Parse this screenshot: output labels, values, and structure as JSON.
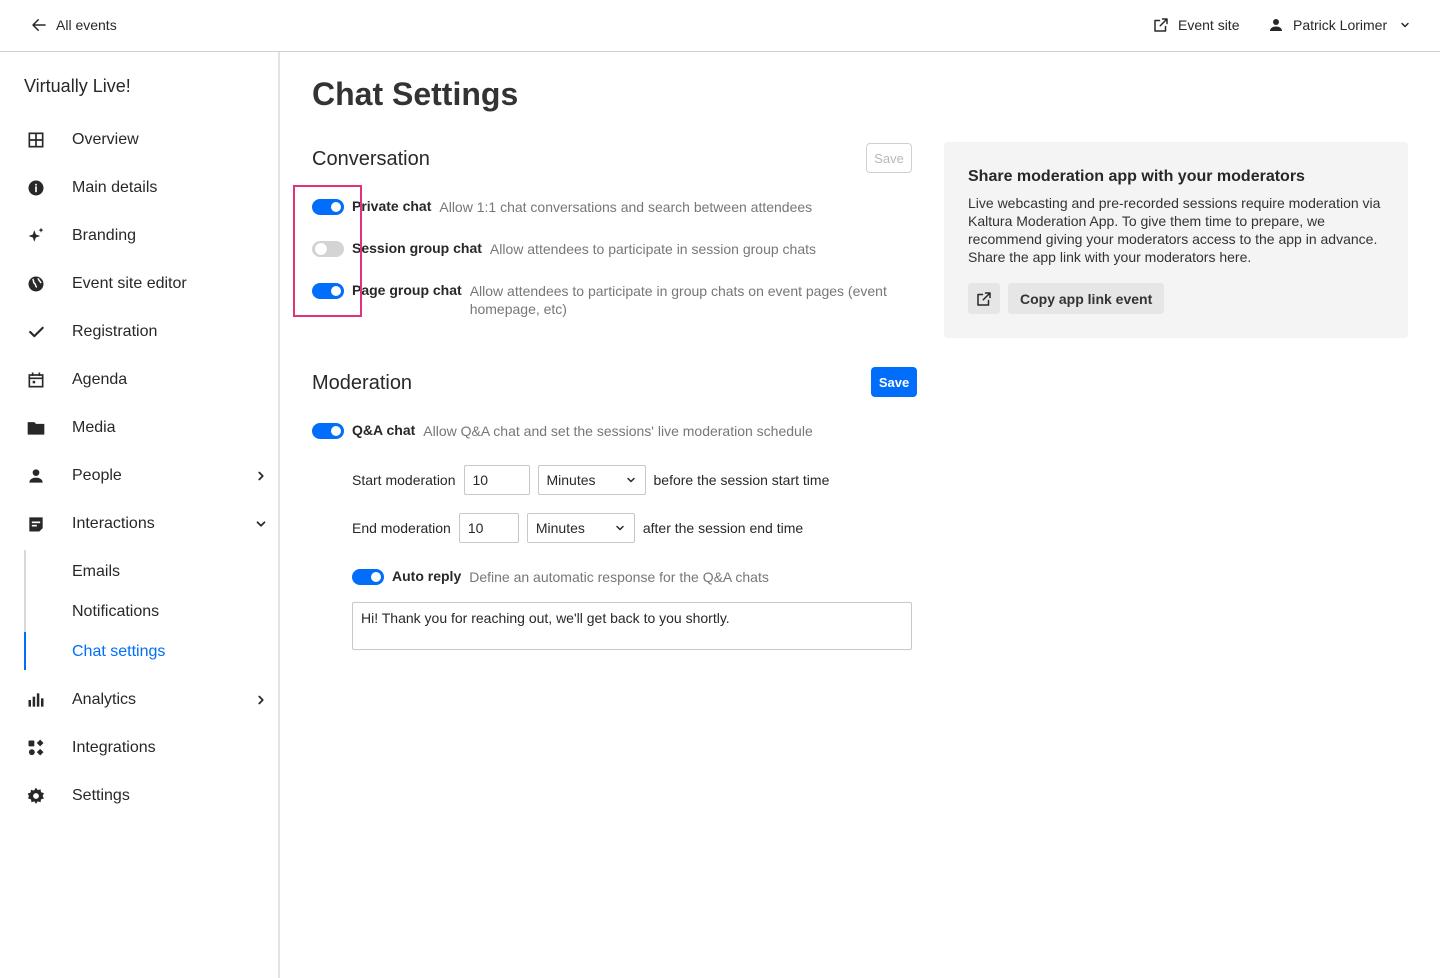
{
  "topbar": {
    "back_label": "All events",
    "event_site_label": "Event site",
    "user_name": "Patrick Lorimer"
  },
  "sidebar": {
    "title": "Virtually Live!",
    "items": [
      {
        "label": "Overview",
        "icon": "grid-icon"
      },
      {
        "label": "Main details",
        "icon": "info-icon"
      },
      {
        "label": "Branding",
        "icon": "sparkle-icon"
      },
      {
        "label": "Event site editor",
        "icon": "globe-icon"
      },
      {
        "label": "Registration",
        "icon": "check-icon"
      },
      {
        "label": "Agenda",
        "icon": "calendar-icon"
      },
      {
        "label": "Media",
        "icon": "folder-icon"
      },
      {
        "label": "People",
        "icon": "person-icon"
      },
      {
        "label": "Interactions",
        "icon": "chat-icon"
      },
      {
        "label": "Analytics",
        "icon": "bar-chart-icon"
      },
      {
        "label": "Integrations",
        "icon": "integrations-icon"
      },
      {
        "label": "Settings",
        "icon": "gear-icon"
      }
    ],
    "sub_items": [
      {
        "label": "Emails"
      },
      {
        "label": "Notifications"
      },
      {
        "label": "Chat settings",
        "active": true
      }
    ]
  },
  "main": {
    "title": "Chat Settings",
    "conversation": {
      "title": "Conversation",
      "save_label": "Save",
      "toggles": [
        {
          "label": "Private chat",
          "description": "Allow 1:1 chat conversations and search between attendees",
          "on": true
        },
        {
          "label": "Session group chat",
          "description": "Allow attendees to participate in session group chats",
          "on": false
        },
        {
          "label": "Page group chat",
          "description": "Allow attendees to participate in group chats on event pages (event homepage, etc)",
          "on": true
        }
      ]
    },
    "moderation": {
      "title": "Moderation",
      "save_label": "Save",
      "qa_toggle": {
        "label": "Q&A chat",
        "description": "Allow Q&A chat and set the sessions' live moderation schedule",
        "on": true
      },
      "start": {
        "label": "Start moderation",
        "value": "10",
        "unit": "Minutes",
        "suffix": "before the session start time"
      },
      "end": {
        "label": "End moderation",
        "value": "10",
        "unit": "Minutes",
        "suffix": "after the session end time"
      },
      "auto_reply": {
        "label": "Auto reply",
        "description": "Define an automatic response for the Q&A chats",
        "on": true,
        "text": "Hi! Thank you for reaching out, we'll get back to you shortly."
      }
    }
  },
  "share_panel": {
    "title": "Share moderation app with your moderators",
    "description": "Live webcasting and pre-recorded sessions require moderation via Kaltura Moderation App. To give them time to prepare, we recommend giving your moderators access to the app in advance. Share the app link with your moderators here.",
    "copy_label": "Copy app link event"
  },
  "colors": {
    "accent": "#006efa",
    "highlight": "#e0347a"
  }
}
